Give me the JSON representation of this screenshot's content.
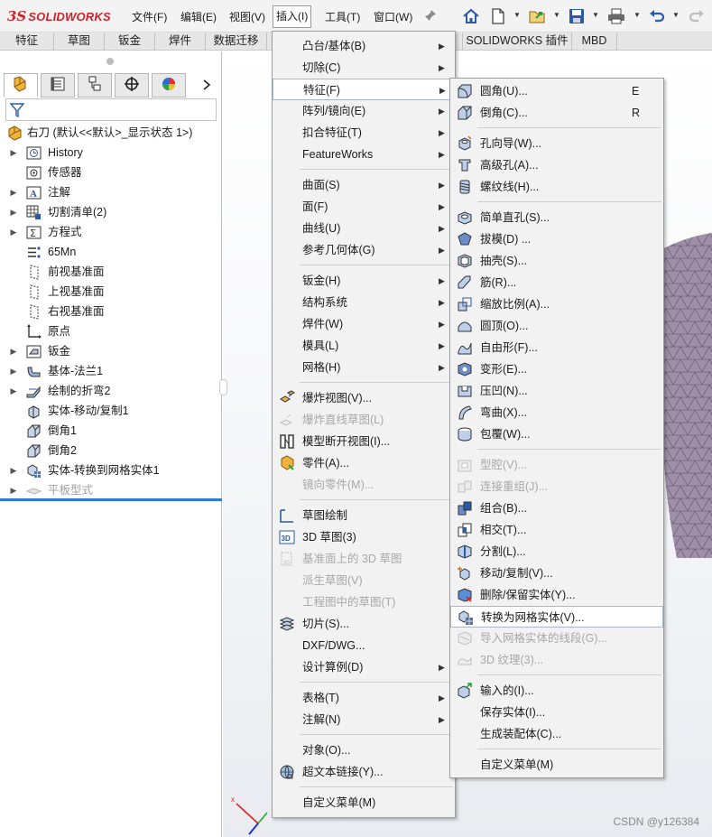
{
  "app": {
    "logo_ds": "3S",
    "logo_brand": "SOLIDWORKS",
    "menus": [
      "文件(F)",
      "编辑(E)",
      "视图(V)",
      "插入(I)",
      "工具(T)",
      "窗口(W)"
    ],
    "toolbar_icons": [
      "home-icon",
      "new-document-icon",
      "open-file-icon",
      "save-icon",
      "print-icon",
      "undo-icon",
      "redo-icon"
    ]
  },
  "command_tabs": [
    "特征",
    "草图",
    "钣金",
    "焊件",
    "数据迁移",
    "SOLIDWORKS 插件",
    "MBD"
  ],
  "tree": {
    "root": "右刀  (默认<<默认>_显示状态 1>)",
    "items": [
      {
        "label": "History",
        "icon": "history-icon",
        "expandable": true,
        "grey": false
      },
      {
        "label": "传感器",
        "icon": "sensor-icon",
        "expandable": false,
        "grey": false
      },
      {
        "label": "注解",
        "icon": "annotation-icon",
        "expandable": true,
        "grey": false
      },
      {
        "label": "切割清单(2)",
        "icon": "cut-list-icon",
        "expandable": true,
        "grey": false
      },
      {
        "label": "方程式",
        "icon": "equation-icon",
        "expandable": true,
        "grey": false
      },
      {
        "label": "65Mn",
        "icon": "material-icon",
        "expandable": false,
        "grey": false
      },
      {
        "label": "前视基准面",
        "icon": "plane-icon",
        "expandable": false,
        "grey": false
      },
      {
        "label": "上视基准面",
        "icon": "plane-icon",
        "expandable": false,
        "grey": false
      },
      {
        "label": "右视基准面",
        "icon": "plane-icon",
        "expandable": false,
        "grey": false
      },
      {
        "label": "原点",
        "icon": "origin-icon",
        "expandable": false,
        "grey": false
      },
      {
        "label": "钣金",
        "icon": "sheet-metal-icon",
        "expandable": true,
        "grey": false
      },
      {
        "label": "基体-法兰1",
        "icon": "base-flange-icon",
        "expandable": true,
        "grey": false
      },
      {
        "label": "绘制的折弯2",
        "icon": "sketched-bend-icon",
        "expandable": true,
        "grey": false
      },
      {
        "label": "实体-移动/复制1",
        "icon": "move-copy-body-icon",
        "expandable": false,
        "grey": false
      },
      {
        "label": "倒角1",
        "icon": "chamfer-icon",
        "expandable": false,
        "grey": false
      },
      {
        "label": "倒角2",
        "icon": "chamfer-icon",
        "expandable": false,
        "grey": false
      },
      {
        "label": "实体-转换到网格实体1",
        "icon": "convert-mesh-icon",
        "expandable": true,
        "grey": false
      },
      {
        "label": "平板型式",
        "icon": "flat-pattern-icon",
        "expandable": true,
        "grey": true
      }
    ]
  },
  "insert_menu": {
    "items": [
      {
        "label": "凸台/基体(B)",
        "sub": true,
        "disabled": false,
        "icon": ""
      },
      {
        "label": "切除(C)",
        "sub": true,
        "disabled": false,
        "icon": ""
      },
      {
        "label": "特征(F)",
        "sub": true,
        "disabled": false,
        "icon": "",
        "highlight": true
      },
      {
        "label": "阵列/镜向(E)",
        "sub": true,
        "disabled": false,
        "icon": ""
      },
      {
        "label": "扣合特征(T)",
        "sub": true,
        "disabled": false,
        "icon": ""
      },
      {
        "label": "FeatureWorks",
        "sub": true,
        "disabled": false,
        "icon": ""
      },
      {
        "sep": true
      },
      {
        "label": "曲面(S)",
        "sub": true,
        "disabled": false,
        "icon": ""
      },
      {
        "label": "面(F)",
        "sub": true,
        "disabled": false,
        "icon": ""
      },
      {
        "label": "曲线(U)",
        "sub": true,
        "disabled": false,
        "icon": ""
      },
      {
        "label": "参考几何体(G)",
        "sub": true,
        "disabled": false,
        "icon": ""
      },
      {
        "sep": true
      },
      {
        "label": "钣金(H)",
        "sub": true,
        "disabled": false,
        "icon": ""
      },
      {
        "label": "结构系统",
        "sub": true,
        "disabled": false,
        "icon": ""
      },
      {
        "label": "焊件(W)",
        "sub": true,
        "disabled": false,
        "icon": ""
      },
      {
        "label": "模具(L)",
        "sub": true,
        "disabled": false,
        "icon": ""
      },
      {
        "label": "网格(H)",
        "sub": true,
        "disabled": false,
        "icon": ""
      },
      {
        "sep": true
      },
      {
        "label": "爆炸视图(V)...",
        "sub": false,
        "disabled": false,
        "icon": "exploded-view-icon"
      },
      {
        "label": "爆炸直线草图(L)",
        "sub": false,
        "disabled": true,
        "icon": "explode-line-sketch-icon"
      },
      {
        "label": "模型断开视图(I)...",
        "sub": false,
        "disabled": false,
        "icon": "model-break-view-icon"
      },
      {
        "label": "零件(A)...",
        "sub": false,
        "disabled": false,
        "icon": "part-icon"
      },
      {
        "label": "镜向零件(M)...",
        "sub": false,
        "disabled": true,
        "icon": ""
      },
      {
        "sep": true
      },
      {
        "label": "草图绘制",
        "sub": false,
        "disabled": false,
        "icon": "sketch-icon"
      },
      {
        "label": "3D 草图(3)",
        "sub": false,
        "disabled": false,
        "icon": "3d-sketch-icon"
      },
      {
        "label": "基准面上的 3D 草图",
        "sub": false,
        "disabled": true,
        "icon": "3d-sketch-on-plane-icon"
      },
      {
        "label": "派生草图(V)",
        "sub": false,
        "disabled": true,
        "icon": ""
      },
      {
        "label": "工程图中的草图(T)",
        "sub": false,
        "disabled": true,
        "icon": ""
      },
      {
        "label": "切片(S)...",
        "sub": false,
        "disabled": false,
        "icon": "slice-icon"
      },
      {
        "label": "DXF/DWG...",
        "sub": false,
        "disabled": false,
        "icon": ""
      },
      {
        "label": "设计算例(D)",
        "sub": true,
        "disabled": false,
        "icon": ""
      },
      {
        "sep": true
      },
      {
        "label": "表格(T)",
        "sub": true,
        "disabled": false,
        "icon": ""
      },
      {
        "label": "注解(N)",
        "sub": true,
        "disabled": false,
        "icon": ""
      },
      {
        "sep": true
      },
      {
        "label": "对象(O)...",
        "sub": false,
        "disabled": false,
        "icon": ""
      },
      {
        "label": "超文本链接(Y)...",
        "sub": false,
        "disabled": false,
        "icon": "hyperlink-icon"
      },
      {
        "sep": true
      },
      {
        "label": "自定义菜单(M)",
        "sub": false,
        "disabled": false,
        "icon": ""
      }
    ]
  },
  "feature_menu": {
    "items": [
      {
        "label": "圆角(U)...",
        "shortcut": "E",
        "disabled": false,
        "icon": "fillet-icon"
      },
      {
        "label": "倒角(C)...",
        "shortcut": "R",
        "disabled": false,
        "icon": "chamfer-icon"
      },
      {
        "sep": true
      },
      {
        "label": "孔向导(W)...",
        "shortcut": "",
        "disabled": false,
        "icon": "hole-wizard-icon"
      },
      {
        "label": "高级孔(A)...",
        "shortcut": "",
        "disabled": false,
        "icon": "advanced-hole-icon"
      },
      {
        "label": "螺纹线(H)...",
        "shortcut": "",
        "disabled": false,
        "icon": "thread-icon"
      },
      {
        "sep": true
      },
      {
        "label": "简单直孔(S)...",
        "shortcut": "",
        "disabled": false,
        "icon": "simple-hole-icon"
      },
      {
        "label": "拔模(D) ...",
        "shortcut": "",
        "disabled": false,
        "icon": "draft-icon"
      },
      {
        "label": "抽壳(S)...",
        "shortcut": "",
        "disabled": false,
        "icon": "shell-icon"
      },
      {
        "label": "筋(R)...",
        "shortcut": "",
        "disabled": false,
        "icon": "rib-icon"
      },
      {
        "label": "缩放比例(A)...",
        "shortcut": "",
        "disabled": false,
        "icon": "scale-icon"
      },
      {
        "label": "圆顶(O)...",
        "shortcut": "",
        "disabled": false,
        "icon": "dome-icon"
      },
      {
        "label": "自由形(F)...",
        "shortcut": "",
        "disabled": false,
        "icon": "freeform-icon"
      },
      {
        "label": "变形(E)...",
        "shortcut": "",
        "disabled": false,
        "icon": "deform-icon"
      },
      {
        "label": "压凹(N)...",
        "shortcut": "",
        "disabled": false,
        "icon": "indent-icon"
      },
      {
        "label": "弯曲(X)...",
        "shortcut": "",
        "disabled": false,
        "icon": "flex-icon"
      },
      {
        "label": "包覆(W)...",
        "shortcut": "",
        "disabled": false,
        "icon": "wrap-icon"
      },
      {
        "sep": true
      },
      {
        "label": "型腔(V)...",
        "shortcut": "",
        "disabled": true,
        "icon": "cavity-icon"
      },
      {
        "label": "连接重组(J)...",
        "shortcut": "",
        "disabled": true,
        "icon": "join-icon"
      },
      {
        "label": "组合(B)...",
        "shortcut": "",
        "disabled": false,
        "icon": "combine-icon"
      },
      {
        "label": "相交(T)...",
        "shortcut": "",
        "disabled": false,
        "icon": "intersect-icon"
      },
      {
        "label": "分割(L)...",
        "shortcut": "",
        "disabled": false,
        "icon": "split-icon"
      },
      {
        "label": "移动/复制(V)...",
        "shortcut": "",
        "disabled": false,
        "icon": "move-copy-icon"
      },
      {
        "label": "删除/保留实体(Y)...",
        "shortcut": "",
        "disabled": false,
        "icon": "delete-keep-body-icon"
      },
      {
        "label": "转换为网格实体(V)...",
        "shortcut": "",
        "disabled": false,
        "icon": "convert-to-mesh-icon",
        "highlight": true
      },
      {
        "label": "导入网格实体的线段(G)...",
        "shortcut": "",
        "disabled": true,
        "icon": "import-mesh-segments-icon"
      },
      {
        "label": "3D 纹理(3)...",
        "shortcut": "",
        "disabled": true,
        "icon": "3d-texture-icon"
      },
      {
        "sep": true
      },
      {
        "label": "输入的(I)...",
        "shortcut": "",
        "disabled": false,
        "icon": "imported-icon"
      },
      {
        "label": "保存实体(I)...",
        "shortcut": "",
        "disabled": false,
        "icon": ""
      },
      {
        "label": "生成装配体(C)...",
        "shortcut": "",
        "disabled": false,
        "icon": ""
      },
      {
        "sep": true
      },
      {
        "label": "自定义菜单(M)",
        "shortcut": "",
        "disabled": false,
        "icon": ""
      }
    ]
  },
  "watermark": "CSDN @y126384",
  "colors": {
    "brand": "#d2232a",
    "accent": "#2a7ad6",
    "model": "#9e8fa8"
  }
}
